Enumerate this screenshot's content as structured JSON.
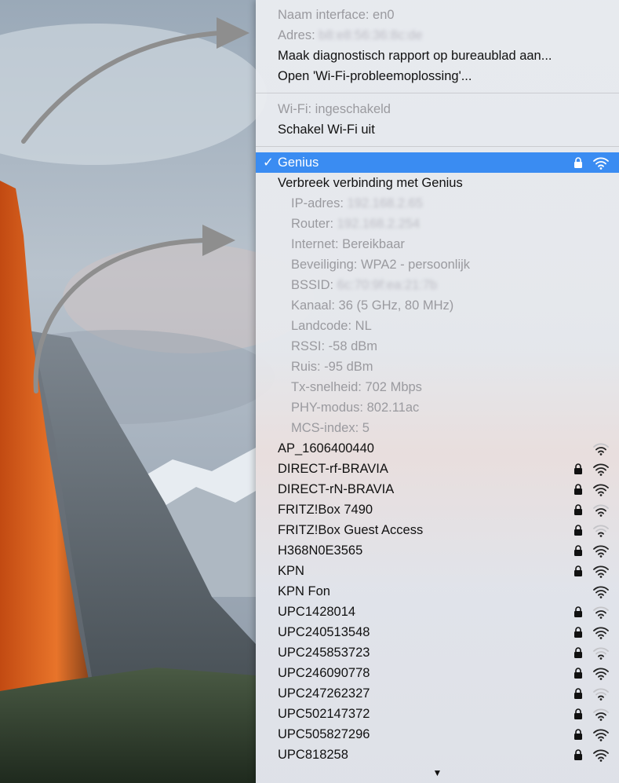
{
  "menu": {
    "interface_name": "Naam interface: en0",
    "address_label": "Adres:",
    "address_value": "b8:e8:56:36:8c:de",
    "diagnostics": "Maak diagnostisch rapport op bureaublad aan...",
    "open_wifi_diagnostics": "Open 'Wi-Fi-probleemoplossing'...",
    "wifi_status": "Wi-Fi: ingeschakeld",
    "wifi_toggle": "Schakel Wi-Fi uit",
    "current_network": {
      "check": "✓",
      "name": "Genius",
      "locked": true,
      "signal": 3
    },
    "disconnect": "Verbreek verbinding met Genius",
    "details": [
      {
        "label": "IP-adres:",
        "value": "192.168.2.65",
        "blurred": true
      },
      {
        "label": "Router:",
        "value": "192.168.2.254",
        "blurred": true
      },
      {
        "label": "Internet: Bereikbaar",
        "value": "",
        "blurred": false
      },
      {
        "label": "Beveiliging: WPA2 - persoonlijk",
        "value": "",
        "blurred": false
      },
      {
        "label": "BSSID:",
        "value": "6c:70:9f:ea:21:7b",
        "blurred": true
      },
      {
        "label": "Kanaal: 36 (5 GHz, 80 MHz)",
        "value": "",
        "blurred": false
      },
      {
        "label": "Landcode: NL",
        "value": "",
        "blurred": false
      },
      {
        "label": "RSSI: -58 dBm",
        "value": "",
        "blurred": false
      },
      {
        "label": "Ruis: -95 dBm",
        "value": "",
        "blurred": false
      },
      {
        "label": "Tx-snelheid: 702 Mbps",
        "value": "",
        "blurred": false
      },
      {
        "label": "PHY-modus: 802.11ac",
        "value": "",
        "blurred": false
      },
      {
        "label": "MCS-index: 5",
        "value": "",
        "blurred": false
      }
    ],
    "networks": [
      {
        "name": "AP_1606400440",
        "locked": false,
        "signal": 2
      },
      {
        "name": "DIRECT-rf-BRAVIA",
        "locked": true,
        "signal": 3
      },
      {
        "name": "DIRECT-rN-BRAVIA",
        "locked": true,
        "signal": 3
      },
      {
        "name": "FRITZ!Box 7490",
        "locked": true,
        "signal": 2
      },
      {
        "name": "FRITZ!Box Guest Access",
        "locked": true,
        "signal": 1
      },
      {
        "name": "H368N0E3565",
        "locked": true,
        "signal": 3
      },
      {
        "name": "KPN",
        "locked": true,
        "signal": 3
      },
      {
        "name": "KPN Fon",
        "locked": false,
        "signal": 3
      },
      {
        "name": "UPC1428014",
        "locked": true,
        "signal": 2
      },
      {
        "name": "UPC240513548",
        "locked": true,
        "signal": 3
      },
      {
        "name": "UPC245853723",
        "locked": true,
        "signal": 1
      },
      {
        "name": "UPC246090778",
        "locked": true,
        "signal": 3
      },
      {
        "name": "UPC247262327",
        "locked": true,
        "signal": 1
      },
      {
        "name": "UPC502147372",
        "locked": true,
        "signal": 2
      },
      {
        "name": "UPC505827296",
        "locked": true,
        "signal": 3
      },
      {
        "name": "UPC818258",
        "locked": true,
        "signal": 3
      }
    ],
    "more_arrow": "▼"
  },
  "colors": {
    "selection": "#3a8cf2",
    "disabled_text": "#9a9a9f",
    "arrow": "#8e8e8e"
  },
  "icons": {
    "lock": "lock-icon",
    "wifi": "wifi-signal-icon",
    "check": "checkmark-icon",
    "scroll_down": "scroll-down-arrow-icon"
  }
}
